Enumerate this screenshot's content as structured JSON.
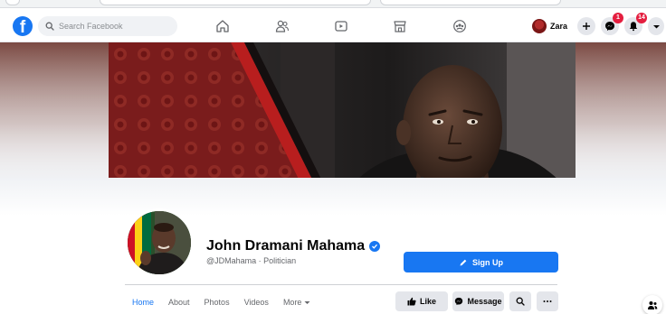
{
  "navbar": {
    "search_placeholder": "Search Facebook",
    "nav_icons": [
      "home-icon",
      "friends-icon",
      "watch-icon",
      "marketplace-icon",
      "groups-icon"
    ],
    "profile_name": "Zara",
    "messenger_badge": "1",
    "notifications_badge": "14"
  },
  "profile": {
    "name": "John Dramani Mahama",
    "handle_and_category": "@JDMahama · Politician",
    "signup_label": "Sign Up",
    "verified": true
  },
  "tabs": [
    {
      "label": "Home",
      "active": true
    },
    {
      "label": "About",
      "active": false
    },
    {
      "label": "Photos",
      "active": false
    },
    {
      "label": "Videos",
      "active": false
    },
    {
      "label": "More",
      "active": false
    }
  ],
  "actions": {
    "like_label": "Like",
    "message_label": "Message",
    "search_icon": "search-icon",
    "more_icon": "ellipsis-icon"
  },
  "colors": {
    "brand": "#1877f2",
    "badge": "#e41e3f",
    "cover_red": "#7b1c1c",
    "flag_red": "#ce1126",
    "flag_gold": "#fcd116",
    "flag_green": "#006b3f"
  }
}
